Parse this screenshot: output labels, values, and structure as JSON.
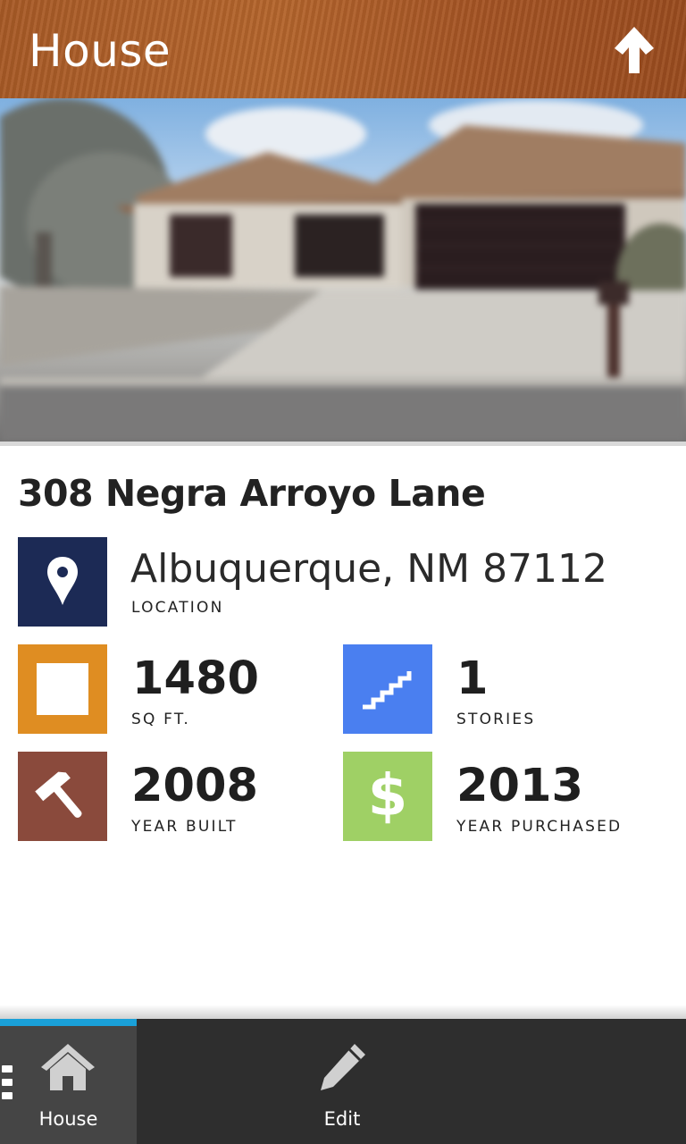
{
  "header": {
    "title": "House"
  },
  "property": {
    "address": "308 Negra Arroyo Lane",
    "location": {
      "value": "Albuquerque, NM 87112",
      "label": "LOCATION"
    },
    "sqft": {
      "value": "1480",
      "label": "SQ FT."
    },
    "stories": {
      "value": "1",
      "label": "STORIES"
    },
    "year_built": {
      "value": "2008",
      "label": "YEAR BUILT"
    },
    "year_purchased": {
      "value": "2013",
      "label": "YEAR PURCHASED"
    }
  },
  "tiles": {
    "location": {
      "color": "#1c2a55",
      "icon": "map-pin-icon"
    },
    "sqft": {
      "color": "#df8d22",
      "icon": "square-icon"
    },
    "stories": {
      "color": "#4a7ff0",
      "icon": "stairs-icon"
    },
    "year_built": {
      "color": "#8a4a3c",
      "icon": "hammer-icon"
    },
    "year_purchased": {
      "color": "#9fd065",
      "icon": "dollar-icon"
    }
  },
  "bottombar": {
    "tabs": [
      {
        "label": "House",
        "icon": "home-icon",
        "active": true
      },
      {
        "label": "Edit",
        "icon": "pencil-icon",
        "active": false
      }
    ],
    "accent": "#1aa0d8"
  }
}
